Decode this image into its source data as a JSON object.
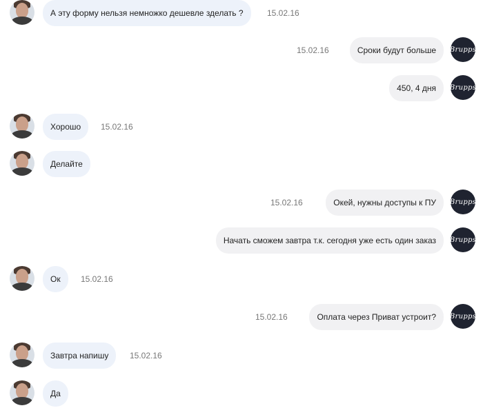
{
  "chat": {
    "avatar_logo_text": "Brupps",
    "messages": [
      {
        "side": "in",
        "text": "А эту форму нельзя немножко дешевле зделать ?",
        "time": "15.02.16"
      },
      {
        "side": "out",
        "text": "Сроки будут больше",
        "time": "15.02.16"
      },
      {
        "side": "out",
        "text": "450, 4 дня",
        "time": ""
      },
      {
        "side": "in",
        "text": "Хорошо",
        "time": "15.02.16"
      },
      {
        "side": "in",
        "text": "Делайте",
        "time": ""
      },
      {
        "side": "out",
        "text": "Окей, нужны доступы к ПУ",
        "time": "15.02.16"
      },
      {
        "side": "out",
        "text": "Начать сможем завтра т.к. сегодня уже есть один заказ",
        "time": ""
      },
      {
        "side": "in",
        "text": "Ок",
        "time": "15.02.16"
      },
      {
        "side": "out",
        "text": "Оплата через Приват устроит?",
        "time": "15.02.16"
      },
      {
        "side": "in",
        "text": "Завтра напишу",
        "time": "15.02.16"
      },
      {
        "side": "in",
        "text": "Да",
        "time": ""
      }
    ]
  }
}
